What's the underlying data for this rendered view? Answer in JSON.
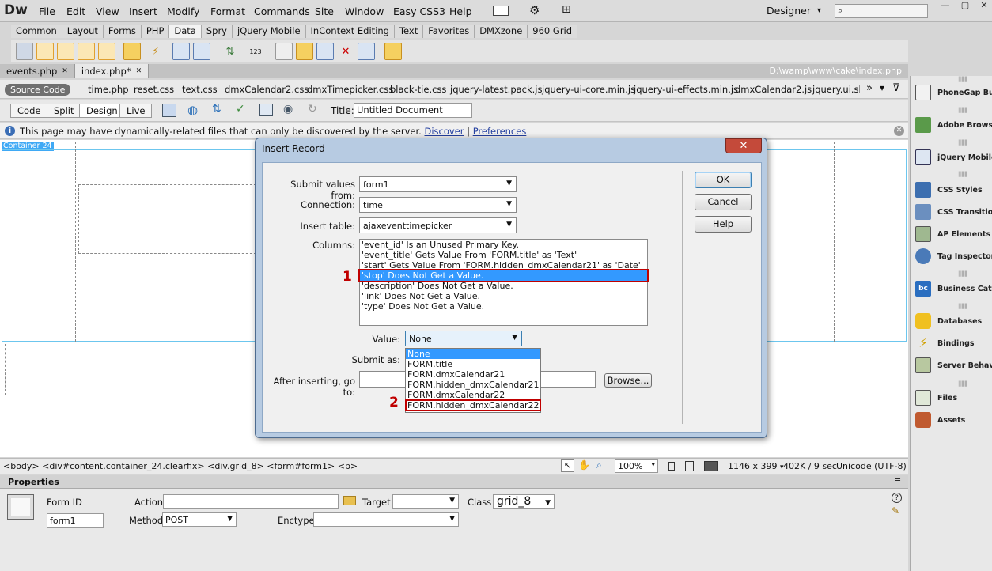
{
  "app": {
    "logo": "Dw"
  },
  "menu": [
    "File",
    "Edit",
    "View",
    "Insert",
    "Modify",
    "Format",
    "Commands",
    "Site",
    "Window",
    "Easy CSS3",
    "Help"
  ],
  "workspace": {
    "label": "Designer",
    "dropdown": "▾"
  },
  "insert_tabs": [
    "Common",
    "Layout",
    "Forms",
    "PHP",
    "Data",
    "Spry",
    "jQuery Mobile",
    "InContext Editing",
    "Text",
    "Favorites",
    "DMXzone",
    "960 Grid"
  ],
  "insert_tabs_active": "Data",
  "doc_tabs": [
    "events.php",
    "index.php*"
  ],
  "doc_tabs_active": "index.php*",
  "doc_path": "D:\\wamp\\www\\cake\\index.php",
  "related_files": {
    "source_code": "Source Code",
    "files": [
      "time.php",
      "reset.css",
      "text.css",
      "dmxCalendar2.css",
      "dmxTimepicker.css",
      "black-tie.css",
      "jquery-latest.pack.js",
      "jquery-ui-core.min.js",
      "jquery-ui-effects.min.js",
      "dmxCalendar2.js",
      "jquery.ui.slid"
    ]
  },
  "doc_toolbar": {
    "views": [
      "Code",
      "Split",
      "Design",
      "Live"
    ],
    "active_view": "Design",
    "title_label": "Title:",
    "title_value": "Untitled Document"
  },
  "info_bar": {
    "text": "This page may have dynamically-related files that can only be discovered by the server.",
    "discover": "Discover",
    "separator": "|",
    "preferences": "Preferences"
  },
  "canvas": {
    "container_label": "Container 24"
  },
  "status_bar": {
    "tag_selector": "<body> <div#content.container_24.clearfix> <div.grid_8> <form#form1> <p>",
    "zoom": "100%",
    "window_size": "1146 x 399",
    "file_info": "402K / 9 sec",
    "encoding": "Unicode (UTF-8)"
  },
  "properties": {
    "header": "Properties",
    "form_id_label": "Form ID",
    "form_id_value": "form1",
    "action_label": "Action",
    "action_value": "",
    "target_label": "Target",
    "target_value": "",
    "class_label": "Class",
    "class_value": "grid_8",
    "method_label": "Method",
    "method_value": "POST",
    "enctype_label": "Enctype",
    "enctype_value": ""
  },
  "right_panel": [
    "PhoneGap Build",
    "Adobe Browser",
    "jQuery Mobile",
    "CSS Styles",
    "CSS Transitions",
    "AP Elements",
    "Tag Inspector",
    "Business Catalyst",
    "Databases",
    "Bindings",
    "Server Behaviors",
    "Files",
    "Assets"
  ],
  "dialog": {
    "title": "Insert Record",
    "close": "✕",
    "submit_values_label": "Submit values from:",
    "submit_values_value": "form1",
    "connection_label": "Connection:",
    "connection_value": "time",
    "insert_table_label": "Insert table:",
    "insert_table_value": "ajaxeventtimepicker",
    "columns_label": "Columns:",
    "columns": [
      "'event_id' Is an Unused Primary Key.",
      "'event_title' Gets Value From 'FORM.title' as 'Text'",
      "'start' Gets Value From 'FORM.hidden_dmxCalendar21' as 'Date'",
      "'stop' Does Not Get a Value.",
      "'description' Does Not Get a Value.",
      "'link' Does Not Get a Value.",
      "'type' Does Not Get a Value."
    ],
    "selected_column_index": 3,
    "value_label": "Value:",
    "value_value": "None",
    "submit_as_label": "Submit as:",
    "after_inserting_label": "After inserting, go to:",
    "after_inserting_value": "",
    "browse_button": "Browse...",
    "ok_button": "OK",
    "cancel_button": "Cancel",
    "help_button": "Help",
    "value_options": [
      "None",
      "FORM.title",
      "FORM.dmxCalendar21",
      "FORM.hidden_dmxCalendar21",
      "FORM.dmxCalendar22",
      "FORM.hidden_dmxCalendar22"
    ],
    "marker_1": "1",
    "marker_2": "2"
  }
}
